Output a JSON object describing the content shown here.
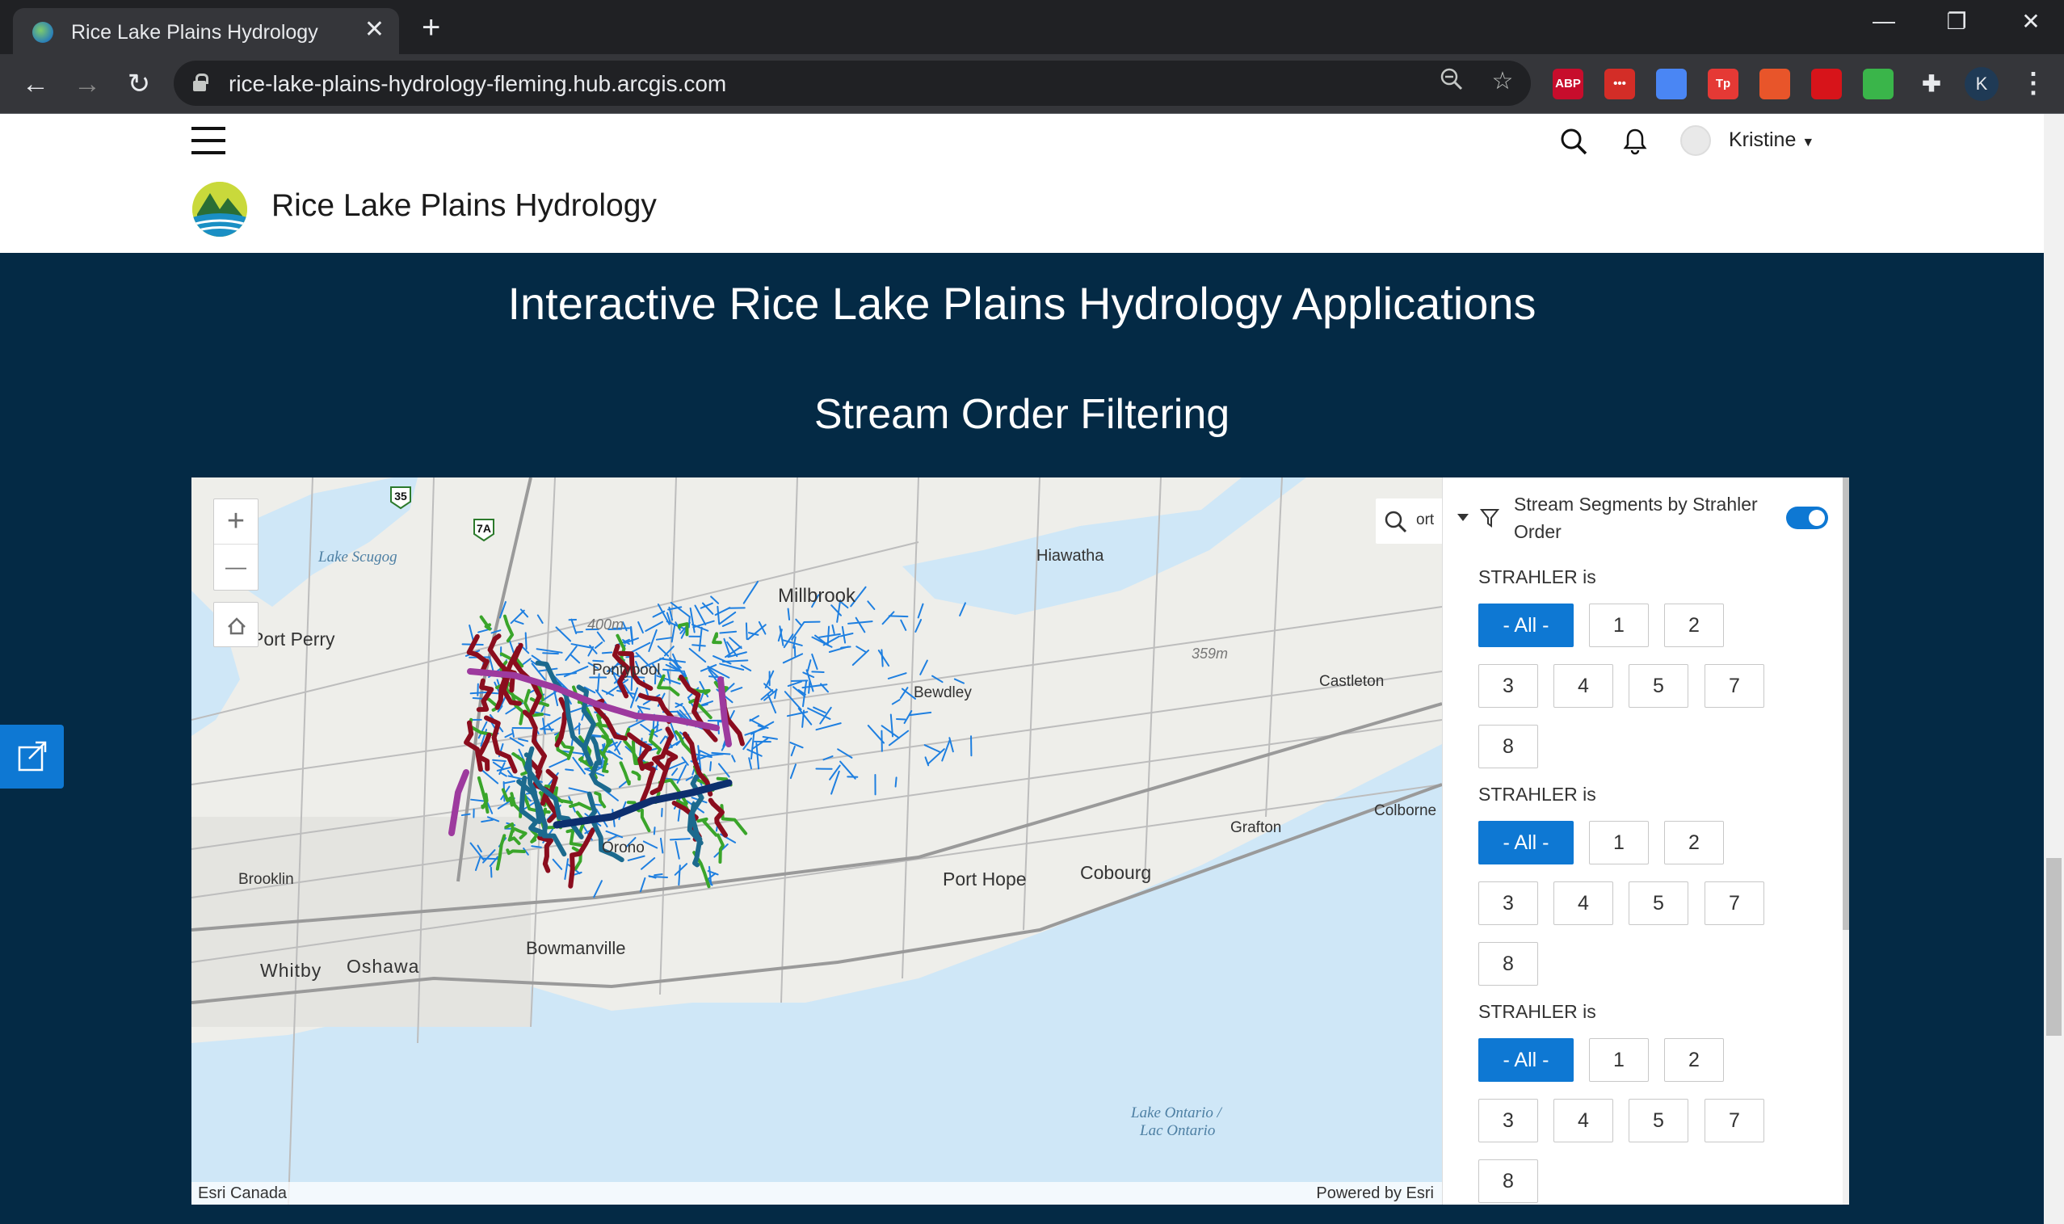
{
  "browser": {
    "tab_title": "Rice Lake Plains Hydrology",
    "tab_close": "✕",
    "new_tab": "+",
    "url": "rice-lake-plains-hydrology-fleming.hub.arcgis.com",
    "window": {
      "minimize": "—",
      "restore": "❐",
      "close": "✕"
    },
    "extensions": [
      {
        "name": "adblock-plus-icon",
        "label": "ABP",
        "color": "#c70d2c"
      },
      {
        "name": "lastpass-icon",
        "label": "•••",
        "color": "#d32d27"
      },
      {
        "name": "docs-icon",
        "label": "",
        "color": "#4a86f4"
      },
      {
        "name": "tp-icon",
        "label": "Tp",
        "color": "#e53935"
      },
      {
        "name": "firefox-like-icon",
        "label": "",
        "color": "#e8552a"
      },
      {
        "name": "acrobat-icon",
        "label": "",
        "color": "#d7141a"
      },
      {
        "name": "green-ext-icon",
        "label": "",
        "color": "#3ab54a"
      },
      {
        "name": "puzzle-icon",
        "label": "",
        "color": "transparent"
      }
    ],
    "profile_initial": "K",
    "menu": "⋮"
  },
  "site": {
    "title": "Rice Lake Plains Hydrology",
    "user_name": "Kristine"
  },
  "main": {
    "heading": "Interactive Rice Lake Plains Hydrology Applications",
    "subheading": "Stream Order Filtering"
  },
  "map": {
    "zoom_in": "+",
    "zoom_out": "—",
    "search_partial": "ort",
    "attribution_left": "Esri Canada",
    "attribution_right": "Powered by Esri",
    "labels": {
      "lake_scugog": "Lake Scugog",
      "millbrook": "Millbrook",
      "hiawatha": "Hiawatha",
      "port_perry": "Port Perry",
      "pontypool": "Pontypool",
      "elev_400": "400m",
      "elev_359": "359m",
      "bewdley": "Bewdley",
      "castleton": "Castleton",
      "colborne": "Colborne",
      "grafton": "Grafton",
      "orono": "Orono",
      "brooklin": "Brooklin",
      "port_hope": "Port Hope",
      "cobourg": "Cobourg",
      "bowmanville": "Bowmanville",
      "whitby": "Whitby",
      "oshawa": "Oshawa",
      "lake_ontario_1": "Lake Ontario /",
      "lake_ontario_2": "Lac Ontario",
      "hwy_35": "35",
      "hwy_7a": "7A"
    },
    "stream_colors": {
      "order_1": "#1e7fe0",
      "order_2": "#3aa52a",
      "order_3": "#8b0d1e",
      "order_4": "#1c6a8e",
      "order_5": "#9d3a9e",
      "order_7": "#0d2f6e"
    }
  },
  "panel": {
    "layer_title": "Stream Segments by Strahler Order",
    "toggle_on": true,
    "filters": [
      {
        "label": "STRAHLER is",
        "options": [
          "- All -",
          "1",
          "2",
          "3",
          "4",
          "5",
          "7",
          "8"
        ],
        "selected": "- All -"
      },
      {
        "label": "STRAHLER is",
        "options": [
          "- All -",
          "1",
          "2",
          "3",
          "4",
          "5",
          "7",
          "8"
        ],
        "selected": "- All -"
      },
      {
        "label": "STRAHLER is",
        "options": [
          "- All -",
          "1",
          "2",
          "3",
          "4",
          "5",
          "7",
          "8"
        ],
        "selected": "- All -"
      }
    ]
  },
  "colors": {
    "accent": "#0e78d3",
    "banner": "#042a45"
  }
}
